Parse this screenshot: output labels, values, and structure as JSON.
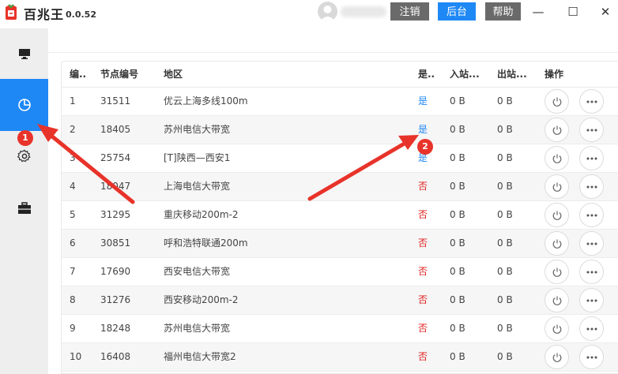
{
  "app": {
    "name": "百兆王",
    "version": "0.0.52"
  },
  "titlebar": {
    "logout_label": "注销",
    "admin_label": "后台",
    "help_label": "帮助",
    "minimize_glyph": "—",
    "maximize_glyph": "☐",
    "close_glyph": "✕"
  },
  "colors": {
    "accent": "#1e88f5",
    "dark_button": "#6a6a6a",
    "flag_yes": "#1e88f5",
    "flag_no": "#e02020",
    "annotation": "#e8332a"
  },
  "sidebar": {
    "items": [
      {
        "icon": "monitor-icon",
        "active": false
      },
      {
        "icon": "pie-chart-icon",
        "active": true
      },
      {
        "icon": "gear-icon",
        "active": false
      },
      {
        "icon": "toolbox-icon",
        "active": false
      }
    ]
  },
  "table": {
    "headers": {
      "no": "编..",
      "node": "节点编号",
      "region": "地区",
      "flag": "是..",
      "in": "入站...",
      "out": "出站...",
      "ops": "操作"
    },
    "rows": [
      {
        "no": "1",
        "node": "31511",
        "region": "优云上海多线100m",
        "flag": "是",
        "in": "0 B",
        "out": "0 B"
      },
      {
        "no": "2",
        "node": "18405",
        "region": "苏州电信大带宽",
        "flag": "是",
        "in": "0 B",
        "out": "0 B"
      },
      {
        "no": "3",
        "node": "25754",
        "region": "[T]陕西—西安1",
        "flag": "是",
        "in": "0 B",
        "out": "0 B"
      },
      {
        "no": "4",
        "node": "18047",
        "region": "上海电信大带宽",
        "flag": "否",
        "in": "0 B",
        "out": "0 B"
      },
      {
        "no": "5",
        "node": "31295",
        "region": "重庆移动200m-2",
        "flag": "否",
        "in": "0 B",
        "out": "0 B"
      },
      {
        "no": "6",
        "node": "30851",
        "region": "呼和浩特联通200m",
        "flag": "否",
        "in": "0 B",
        "out": "0 B"
      },
      {
        "no": "7",
        "node": "17690",
        "region": "西安电信大带宽",
        "flag": "否",
        "in": "0 B",
        "out": "0 B"
      },
      {
        "no": "8",
        "node": "31276",
        "region": "西安移动200m-2",
        "flag": "否",
        "in": "0 B",
        "out": "0 B"
      },
      {
        "no": "9",
        "node": "18248",
        "region": "苏州电信大带宽",
        "flag": "否",
        "in": "0 B",
        "out": "0 B"
      },
      {
        "no": "10",
        "node": "16408",
        "region": "福州电信大带宽2",
        "flag": "否",
        "in": "0 B",
        "out": "0 B"
      }
    ]
  },
  "annotations": {
    "badge_1": "1",
    "badge_2": "2"
  }
}
